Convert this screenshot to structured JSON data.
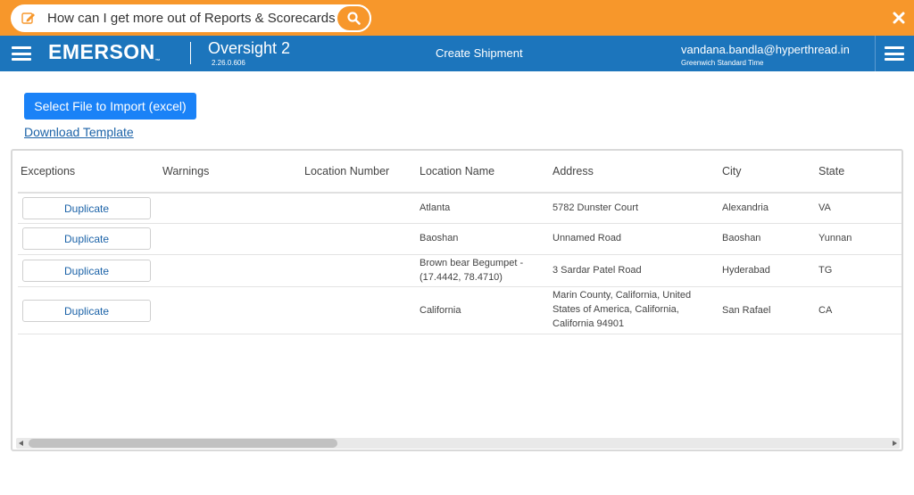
{
  "help": {
    "question": "How can I get more out of Reports & Scorecards?"
  },
  "header": {
    "brand": "EMERSON",
    "app_name": "Oversight 2",
    "version": "2.26.0.606",
    "page_title": "Create Shipment",
    "user_email": "vandana.bandla@hyperthread.in",
    "timezone": "Greenwich Standard Time"
  },
  "actions": {
    "import_label": "Select File to Import (excel)",
    "download_label": "Download Template"
  },
  "table": {
    "columns": [
      "Exceptions",
      "Warnings",
      "Location Number",
      "Location Name",
      "Address",
      "City",
      "State"
    ],
    "rows": [
      {
        "exception": "Duplicate",
        "warning": "",
        "location_number": "",
        "location_name": "Atlanta",
        "address": "5782 Dunster Court",
        "city": "Alexandria",
        "state": "VA"
      },
      {
        "exception": "Duplicate",
        "warning": "",
        "location_number": "",
        "location_name": "Baoshan",
        "address": "Unnamed Road",
        "city": "Baoshan",
        "state": "Yunnan"
      },
      {
        "exception": "Duplicate",
        "warning": "",
        "location_number": "",
        "location_name": "Brown bear Begumpet - (17.4442, 78.4710)",
        "address": "3 Sardar Patel Road",
        "city": "Hyderabad",
        "state": "TG"
      },
      {
        "exception": "Duplicate",
        "warning": "",
        "location_number": "",
        "location_name": "California",
        "address": "Marin County, California, United States of America, California, California 94901",
        "city": "San Rafael",
        "state": "CA"
      }
    ]
  },
  "colors": {
    "help_bar": "#f7972b",
    "app_bar": "#1c75bc",
    "primary_button": "#1a82f7",
    "link": "#1c63a8"
  },
  "icons": {
    "edit": "edit-icon",
    "search": "search-icon",
    "close": "close-icon",
    "menu": "hamburger-menu-icon"
  }
}
